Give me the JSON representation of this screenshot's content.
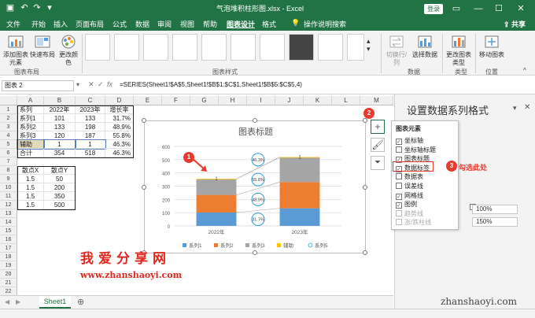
{
  "titlebar": {
    "autosave_icon": "autosave-icon",
    "title": "气泡堆积柱形图.xlsx  -  Excel",
    "login": "登录",
    "minimize": "—",
    "restore": "☐",
    "close": "✕"
  },
  "tabs": [
    "文件",
    "开始",
    "插入",
    "页面布局",
    "公式",
    "数据",
    "审阅",
    "视图",
    "帮助",
    "图表设计",
    "格式"
  ],
  "tell_me": "操作说明搜索",
  "share": "共享",
  "ribbon": {
    "add_element": "添加图表元素",
    "quick_layout": "快速布局",
    "change_color": "更改颜色",
    "switch_row_col": "切换行/列",
    "select_data": "选择数据",
    "change_type": "更改图表类型",
    "move_chart": "移动图表",
    "groups": [
      "图表布局",
      "图表样式",
      "数据",
      "类型",
      "位置"
    ]
  },
  "formula_bar": {
    "name_box": "图表 2",
    "formula": "=SERIES(Sheet1!$A$5,Sheet1!$B$1:$C$1,Sheet1!$B$5:$C$5,4)"
  },
  "columns": [
    "A",
    "B",
    "C",
    "D",
    "E",
    "F",
    "G",
    "H",
    "I",
    "J",
    "K",
    "L",
    "M"
  ],
  "rows": [
    "1",
    "2",
    "3",
    "4",
    "5",
    "6",
    "7",
    "8",
    "9",
    "10",
    "11",
    "12",
    "13",
    "14",
    "15",
    "16",
    "17",
    "18",
    "19",
    "20",
    "21",
    "22",
    "23"
  ],
  "table1": {
    "header": [
      "系列",
      "2022年",
      "2023年",
      "增长率"
    ],
    "rows": [
      [
        "系列1",
        "101",
        "133",
        "31.7%"
      ],
      [
        "系列2",
        "133",
        "198",
        "48.9%"
      ],
      [
        "系列3",
        "120",
        "187",
        "55.8%"
      ],
      [
        "辅助",
        "1",
        "1",
        "46.3%"
      ],
      [
        "合计",
        "354",
        "518",
        "46.3%"
      ]
    ]
  },
  "table2": {
    "header": [
      "散点X",
      "散点Y"
    ],
    "rows": [
      [
        "1.5",
        "50"
      ],
      [
        "1.5",
        "200"
      ],
      [
        "1.5",
        "350"
      ],
      [
        "1.5",
        "500"
      ]
    ]
  },
  "sheet_tab": "Sheet1",
  "chart_data": {
    "type": "bar",
    "title": "图表标题",
    "categories": [
      "2022年",
      "2023年"
    ],
    "ylim": [
      0,
      600
    ],
    "yticks": [
      "0",
      "100",
      "200",
      "300",
      "400",
      "500",
      "600"
    ],
    "series": [
      {
        "name": "系列1",
        "values": [
          101,
          133
        ],
        "color": "#5b9bd5"
      },
      {
        "name": "系列2",
        "values": [
          133,
          198
        ],
        "color": "#ed7d31"
      },
      {
        "name": "系列3",
        "values": [
          120,
          187
        ],
        "color": "#a5a5a5"
      },
      {
        "name": "辅助",
        "values": [
          1,
          1
        ],
        "color": "#ffc000"
      }
    ],
    "bubble_series": {
      "name": "系列5",
      "labels": [
        "31.7%",
        "48.9%",
        "55.8%",
        "46.3%"
      ],
      "y": [
        50,
        200,
        350,
        500
      ]
    },
    "data_labels": [
      "1",
      "1"
    ],
    "legend": [
      "系列1",
      "系列2",
      "系列3",
      "辅助",
      "系列5"
    ],
    "legend_position": "bottom"
  },
  "popup": {
    "header": "图表元素",
    "items": [
      {
        "label": "坐标轴",
        "checked": true,
        "disabled": false
      },
      {
        "label": "坐标轴标题",
        "checked": false,
        "disabled": false
      },
      {
        "label": "图表标题",
        "checked": true,
        "disabled": false
      },
      {
        "label": "数据标签",
        "checked": true,
        "disabled": false
      },
      {
        "label": "数据表",
        "checked": false,
        "disabled": false
      },
      {
        "label": "误差线",
        "checked": false,
        "disabled": false
      },
      {
        "label": "网格线",
        "checked": true,
        "disabled": false
      },
      {
        "label": "图例",
        "checked": true,
        "disabled": false
      },
      {
        "label": "趋势线",
        "checked": false,
        "disabled": true
      },
      {
        "label": "涨/跌柱线",
        "checked": false,
        "disabled": true
      }
    ]
  },
  "pane": {
    "title": "设置数据系列格式",
    "overlap": "100%",
    "gap_width": "150%"
  },
  "annotations": {
    "badge1": "1",
    "badge2": "2",
    "badge3": "3",
    "check_here": "勾选此处"
  },
  "watermarks": {
    "cn": "我爱分享网",
    "url": "www.zhanshaoyi.com",
    "right": "zhanshaoyi.com"
  }
}
